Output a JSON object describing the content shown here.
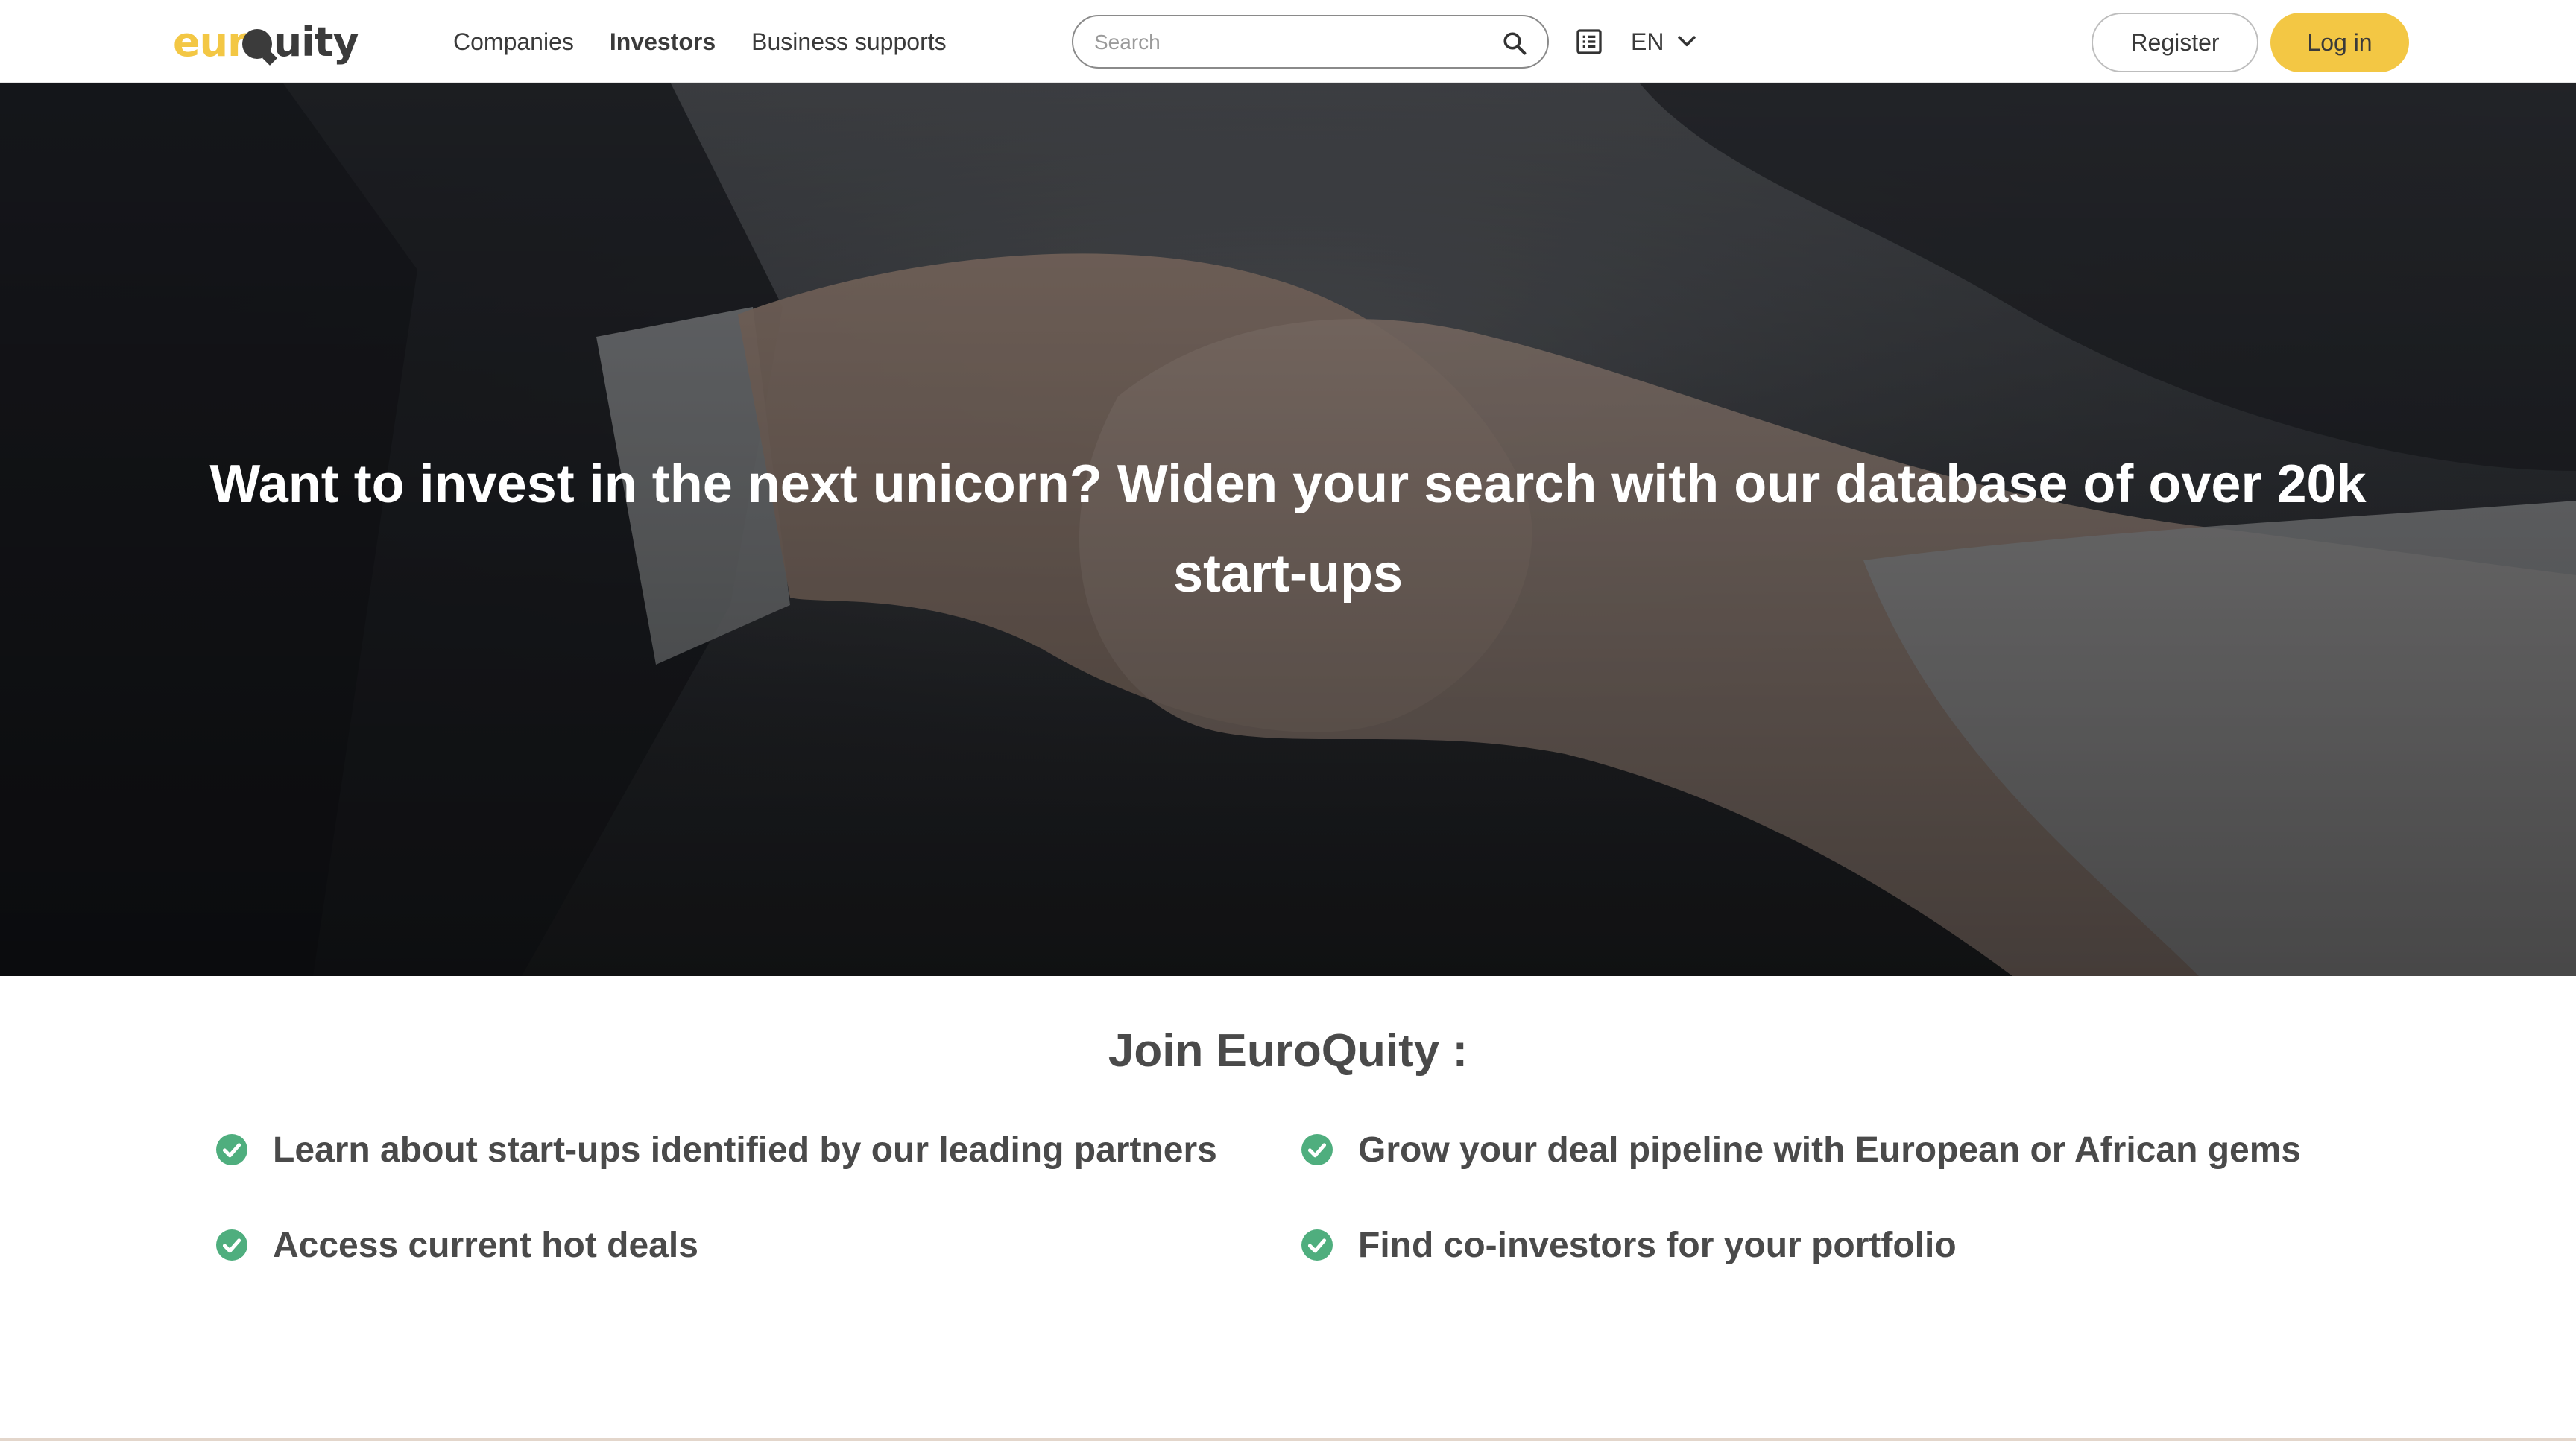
{
  "brand": {
    "logo_part1": "eur",
    "logo_part2": "uity"
  },
  "nav": {
    "items": [
      {
        "label": "Companies",
        "active": false
      },
      {
        "label": "Investors",
        "active": true
      },
      {
        "label": "Business supports",
        "active": false
      }
    ]
  },
  "search": {
    "placeholder": "Search",
    "value": ""
  },
  "icons": {
    "search": "search-icon",
    "catalog": "list-icon",
    "chevron": "chevron-down-icon",
    "check": "check-circle-icon"
  },
  "language": {
    "current": "EN"
  },
  "auth": {
    "register_label": "Register",
    "login_label": "Log in"
  },
  "hero": {
    "title": "Want to invest in the next unicorn? Widen your search with our database of over 20k start-ups"
  },
  "join": {
    "title": "Join EuroQuity :",
    "benefits": [
      "Learn about start-ups identified by our leading partners",
      "Grow your deal pipeline with European or African gems",
      "Access current hot deals",
      "Find co-investors for your portfolio"
    ]
  },
  "colors": {
    "accent": "#f3c744",
    "check": "#4fae7e",
    "text": "#4a4a4a"
  }
}
